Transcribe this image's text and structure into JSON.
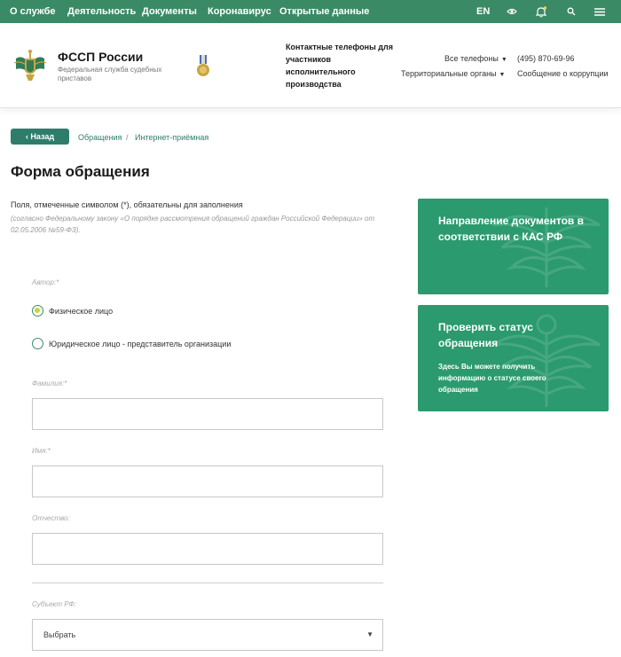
{
  "topnav": {
    "items": [
      "О службе",
      "Деятельность",
      "Документы",
      "Коронавирус",
      "Открытые данные"
    ],
    "lang": "EN"
  },
  "header": {
    "brand": "ФССП России",
    "brand_sub": "Федеральная служба судебных приставов",
    "contact": "Контактные телефоны для участников исполнительного производства",
    "all_phones": "Все телефоны",
    "territorial": "Территориальные органы",
    "phone": "(495) 870-69-96",
    "corruption": "Сообщение о коррупции"
  },
  "breadcrumb": {
    "back": "‹  Назад",
    "items": [
      "Обращения",
      "Интернет-приёмная"
    ],
    "sep": "/"
  },
  "page": {
    "title": "Форма обращения",
    "required_note": "Поля, отмеченные символом (*), обязательны для заполнения",
    "law_note": "(согласно Федеральному закону «О порядке рассмотрения обращений граждан Российской Федерации» от 02.05.2006 №59-ФЗ)."
  },
  "form": {
    "author_label": "Автор:*",
    "author_options": [
      "Физическое лицо",
      "Юридическое лицо - представитель организации"
    ],
    "author_selected": 0,
    "surname_label": "Фамилия:*",
    "name_label": "Имя:*",
    "patronymic_label": "Отчество:",
    "region_label": "Субъект РФ:",
    "region_value": "Выбрать"
  },
  "cards": [
    {
      "title": "Направление документов в соответствии с КАС РФ"
    },
    {
      "title": "Проверить статус обращения",
      "text": "Здесь Вы можете получить информацию о статусе своего обращения"
    }
  ],
  "colors": {
    "nav": "#3b8a66",
    "card": "#2b9a6e",
    "accent": "#2e7d6b",
    "radio_fill": "#c9d43a"
  },
  "icons": [
    "eye-icon",
    "bell-icon",
    "search-icon",
    "menu-icon"
  ]
}
